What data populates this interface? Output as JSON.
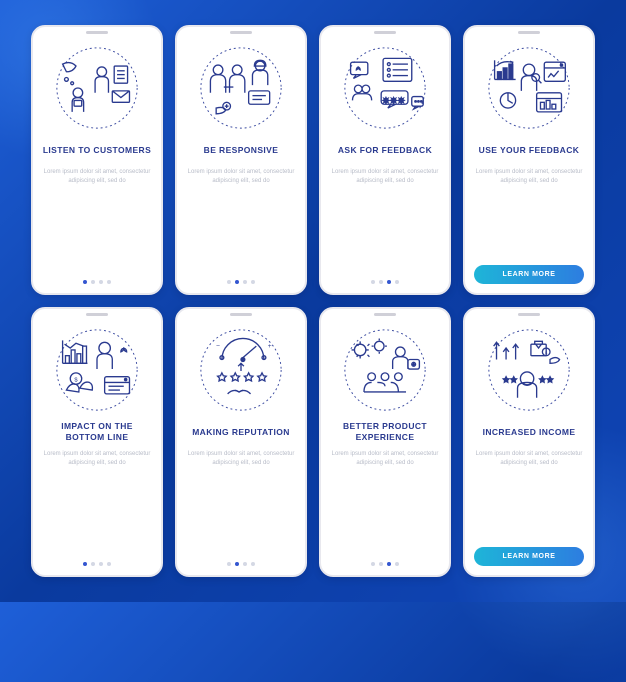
{
  "colors": {
    "stroke": "#2a3a8f",
    "dotted": "#3a4aa0",
    "accent_btn": "#1eb5d8"
  },
  "placeholder_body": "Lorem ipsum dolor sit amet, consectetur adipiscing elit, sed do",
  "learn_more_label": "LEARN MORE",
  "cards": [
    {
      "id": "listen",
      "title": "LISTEN TO CUSTOMERS",
      "active_dot": 0,
      "has_button": false
    },
    {
      "id": "responsive",
      "title": "BE RESPONSIVE",
      "active_dot": 1,
      "has_button": false
    },
    {
      "id": "ask",
      "title": "ASK FOR FEEDBACK",
      "active_dot": 2,
      "has_button": false
    },
    {
      "id": "use",
      "title": "USE YOUR FEEDBACK",
      "active_dot": 3,
      "has_button": true
    },
    {
      "id": "impact",
      "title": "IMPACT ON THE BOTTOM LINE",
      "active_dot": 0,
      "has_button": false
    },
    {
      "id": "reputation",
      "title": "MAKING REPUTATION",
      "active_dot": 1,
      "has_button": false
    },
    {
      "id": "product",
      "title": "BETTER PRODUCT EXPERIENCE",
      "active_dot": 2,
      "has_button": false
    },
    {
      "id": "income",
      "title": "INCREASED INCOME",
      "active_dot": 3,
      "has_button": true
    }
  ]
}
